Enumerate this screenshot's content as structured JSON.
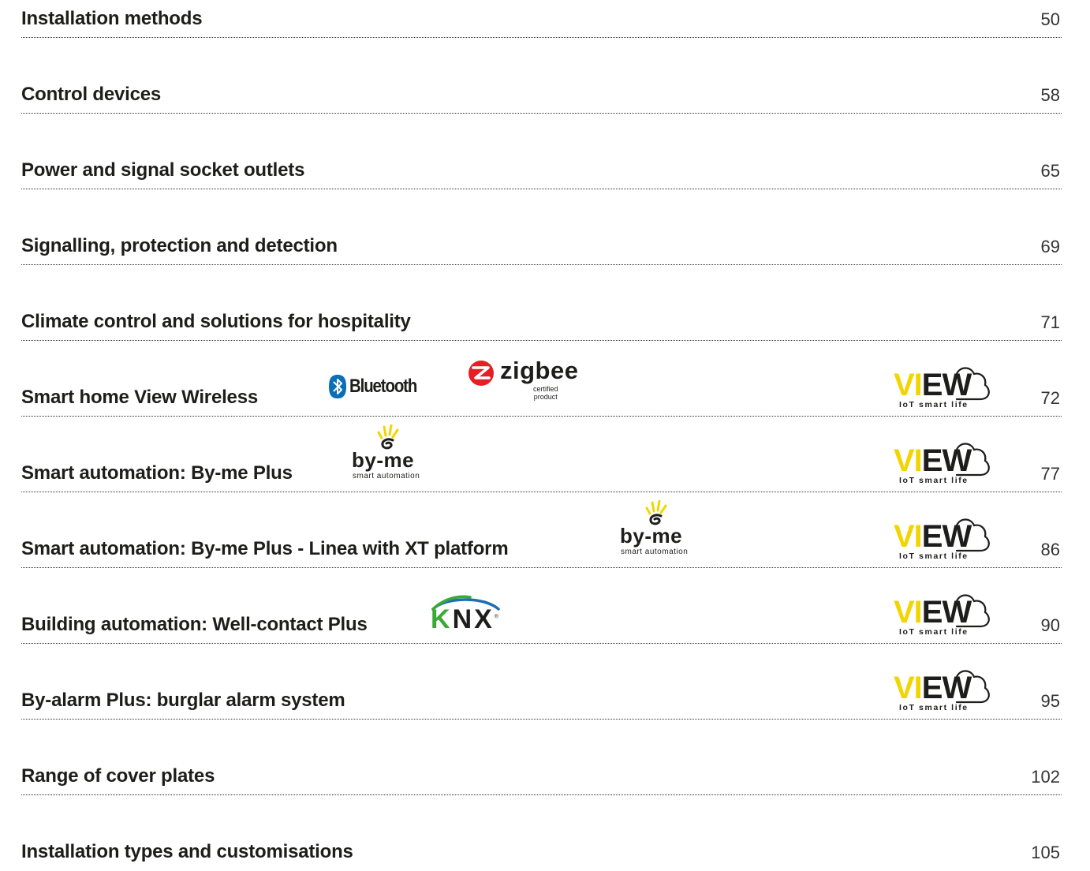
{
  "toc": [
    {
      "title": "Installation methods",
      "page": "50"
    },
    {
      "title": "Control devices",
      "page": "58"
    },
    {
      "title": "Power and signal socket outlets",
      "page": "65"
    },
    {
      "title": "Signalling, protection and detection",
      "page": "69"
    },
    {
      "title": "Climate control and solutions for hospitality",
      "page": "71"
    },
    {
      "title": "Smart home View Wireless",
      "page": "72"
    },
    {
      "title": "Smart automation: By-me Plus",
      "page": "77"
    },
    {
      "title": "Smart automation: By-me Plus - Linea with XT platform",
      "page": "86"
    },
    {
      "title": "Building automation: Well-contact Plus",
      "page": "90"
    },
    {
      "title": "By-alarm Plus: burglar alarm system",
      "page": "95"
    },
    {
      "title": "Range of cover plates",
      "page": "102"
    },
    {
      "title": "Installation types and customisations",
      "page": "105"
    }
  ],
  "logos": {
    "bluetooth": {
      "text": "Bluetooth",
      "mark": "®"
    },
    "zigbee": {
      "text": "zigbee",
      "certified": "certified",
      "product": "product"
    },
    "byme": {
      "text": "by-me",
      "subtitle": "smart automation"
    },
    "knx": {
      "k": "K",
      "nx": "NX",
      "mark": "®"
    },
    "view": {
      "vi": "VI",
      "ew": "EW",
      "subtitle": "IoT smart life"
    }
  },
  "colors": {
    "text": "#1d1d1b",
    "bluetooth_blue": "#0a6fb8",
    "zigbee_red": "#e41f26",
    "view_yellow": "#f2d500",
    "byme_yellow": "#f2d500",
    "knx_green": "#3aa935",
    "knx_blue": "#1f6fb2"
  }
}
